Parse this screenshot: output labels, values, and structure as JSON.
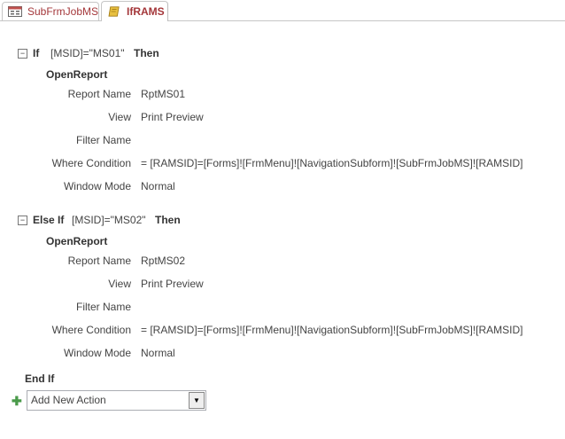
{
  "tabs": [
    {
      "label": "SubFrmJobMS",
      "icon": "form-icon"
    },
    {
      "label": "IfRAMS",
      "icon": "macro-icon",
      "active": true
    }
  ],
  "blocks": [
    {
      "keyword": "If",
      "condition": "[MSID]=\"MS01\"",
      "then": "Then",
      "action": "OpenReport",
      "args": [
        {
          "label": "Report Name",
          "value": "RptMS01"
        },
        {
          "label": "View",
          "value": "Print Preview"
        },
        {
          "label": "Filter Name",
          "value": ""
        },
        {
          "label": "Where Condition",
          "value": "= [RAMSID]=[Forms]![FrmMenu]![NavigationSubform]![SubFrmJobMS]![RAMSID]"
        },
        {
          "label": "Window Mode",
          "value": "Normal"
        }
      ]
    },
    {
      "keyword": "Else If",
      "condition": "[MSID]=\"MS02\"",
      "then": "Then",
      "action": "OpenReport",
      "args": [
        {
          "label": "Report Name",
          "value": "RptMS02"
        },
        {
          "label": "View",
          "value": "Print Preview"
        },
        {
          "label": "Filter Name",
          "value": ""
        },
        {
          "label": "Where Condition",
          "value": "= [RAMSID]=[Forms]![FrmMenu]![NavigationSubform]![SubFrmJobMS]![RAMSID]"
        },
        {
          "label": "Window Mode",
          "value": "Normal"
        }
      ]
    }
  ],
  "end_if": "End If",
  "add_action": {
    "value": "Add New Action"
  }
}
